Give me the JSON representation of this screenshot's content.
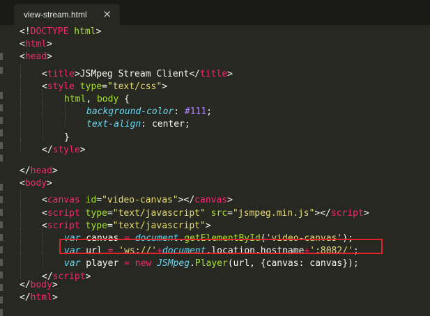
{
  "tab": {
    "title": "view-stream.html",
    "close_icon": "×"
  },
  "lines": [
    {
      "indent": 0,
      "tokens": [
        [
          "p",
          "<!"
        ],
        [
          "tg",
          "DOCTYPE"
        ],
        [
          "p",
          " "
        ],
        [
          "at",
          "html"
        ],
        [
          "p",
          ">"
        ]
      ]
    },
    {
      "indent": 0,
      "tokens": [
        [
          "p",
          "<"
        ],
        [
          "tg",
          "html"
        ],
        [
          "p",
          ">"
        ]
      ]
    },
    {
      "indent": 0,
      "tokens": [
        [
          "p",
          "<"
        ],
        [
          "tg",
          "head"
        ],
        [
          "p",
          ">"
        ]
      ]
    },
    {
      "indent": 1,
      "tokens": [
        [
          "p",
          "<"
        ],
        [
          "tg",
          "title"
        ],
        [
          "p",
          ">JSMpeg Stream Client</"
        ],
        [
          "tg",
          "title"
        ],
        [
          "p",
          ">"
        ]
      ]
    },
    {
      "indent": 1,
      "tokens": [
        [
          "p",
          "<"
        ],
        [
          "tg",
          "style"
        ],
        [
          "p",
          " "
        ],
        [
          "at",
          "type"
        ],
        [
          "p",
          "="
        ],
        [
          "st",
          "\"text/css\""
        ],
        [
          "p",
          ">"
        ]
      ]
    },
    {
      "indent": 2,
      "tokens": [
        [
          "sel",
          "html"
        ],
        [
          "p",
          ", "
        ],
        [
          "sel",
          "body"
        ],
        [
          "p",
          " {"
        ]
      ]
    },
    {
      "indent": 3,
      "tokens": [
        [
          "pr",
          "background-color"
        ],
        [
          "p",
          ": "
        ],
        [
          "nm",
          "#111"
        ],
        [
          "p",
          ";"
        ]
      ]
    },
    {
      "indent": 3,
      "tokens": [
        [
          "pr",
          "text-align"
        ],
        [
          "p",
          ": "
        ],
        [
          "p",
          "center"
        ],
        [
          "p",
          ";"
        ]
      ]
    },
    {
      "indent": 2,
      "tokens": [
        [
          "p",
          "}"
        ]
      ]
    },
    {
      "indent": 1,
      "tokens": [
        [
          "p",
          "</"
        ],
        [
          "tg",
          "style"
        ],
        [
          "p",
          ">"
        ]
      ]
    },
    {
      "indent": 0,
      "tokens": []
    },
    {
      "indent": 0,
      "tokens": [
        [
          "p",
          "</"
        ],
        [
          "tg",
          "head"
        ],
        [
          "p",
          ">"
        ]
      ]
    },
    {
      "indent": 0,
      "tokens": [
        [
          "p",
          "<"
        ],
        [
          "tg",
          "body"
        ],
        [
          "p",
          ">"
        ]
      ]
    },
    {
      "indent": 1,
      "tokens": [
        [
          "p",
          "<"
        ],
        [
          "tg",
          "canvas"
        ],
        [
          "p",
          " "
        ],
        [
          "at",
          "id"
        ],
        [
          "p",
          "="
        ],
        [
          "st",
          "\"video-canvas\""
        ],
        [
          "p",
          "></"
        ],
        [
          "tg",
          "canvas"
        ],
        [
          "p",
          ">"
        ]
      ]
    },
    {
      "indent": 1,
      "tokens": [
        [
          "p",
          "<"
        ],
        [
          "tg",
          "script"
        ],
        [
          "p",
          " "
        ],
        [
          "at",
          "type"
        ],
        [
          "p",
          "="
        ],
        [
          "st",
          "\"text/javascript\""
        ],
        [
          "p",
          " "
        ],
        [
          "at",
          "src"
        ],
        [
          "p",
          "="
        ],
        [
          "st",
          "\"jsmpeg.min.js\""
        ],
        [
          "p",
          "></"
        ],
        [
          "tg",
          "script"
        ],
        [
          "p",
          ">"
        ]
      ]
    },
    {
      "indent": 1,
      "tokens": [
        [
          "p",
          "<"
        ],
        [
          "tg",
          "script"
        ],
        [
          "p",
          " "
        ],
        [
          "at",
          "type"
        ],
        [
          "p",
          "="
        ],
        [
          "st",
          "\"text/javascript\""
        ],
        [
          "p",
          ">"
        ]
      ]
    },
    {
      "indent": 2,
      "tokens": [
        [
          "kw",
          "var"
        ],
        [
          "p",
          " canvas "
        ],
        [
          "op",
          "="
        ],
        [
          "p",
          " "
        ],
        [
          "cl",
          "document"
        ],
        [
          "p",
          "."
        ],
        [
          "fn",
          "getElementById"
        ],
        [
          "p",
          "("
        ],
        [
          "st",
          "'video-canvas'"
        ],
        [
          "p",
          ");"
        ]
      ]
    },
    {
      "indent": 2,
      "tokens": [
        [
          "kw",
          "var"
        ],
        [
          "p",
          " url "
        ],
        [
          "op",
          "="
        ],
        [
          "p",
          " "
        ],
        [
          "st",
          "'ws://'"
        ],
        [
          "op",
          "+"
        ],
        [
          "cl",
          "document"
        ],
        [
          "p",
          ".location.hostname"
        ],
        [
          "op",
          "+"
        ],
        [
          "st",
          "':8082/'"
        ],
        [
          "p",
          ";"
        ]
      ]
    },
    {
      "indent": 2,
      "tokens": [
        [
          "kw",
          "var"
        ],
        [
          "p",
          " player "
        ],
        [
          "op",
          "="
        ],
        [
          "p",
          " "
        ],
        [
          "op",
          "new"
        ],
        [
          "p",
          " "
        ],
        [
          "cl",
          "JSMpeg"
        ],
        [
          "p",
          "."
        ],
        [
          "fn",
          "Player"
        ],
        [
          "p",
          "(url, {canvas: canvas});"
        ]
      ]
    },
    {
      "indent": 1,
      "tokens": [
        [
          "p",
          "</"
        ],
        [
          "tg",
          "script"
        ],
        [
          "p",
          ">"
        ]
      ]
    },
    {
      "indent": 0,
      "tokens": [
        [
          "p",
          "</"
        ],
        [
          "tg",
          "body"
        ],
        [
          "p",
          ">"
        ]
      ]
    },
    {
      "indent": 0,
      "tokens": [
        [
          "p",
          "</"
        ],
        [
          "tg",
          "html"
        ],
        [
          "p",
          ">"
        ]
      ]
    }
  ],
  "highlighted_line": 17,
  "colors": {
    "background": "#272822",
    "tag": "#f92672",
    "attribute": "#a6e22e",
    "string": "#e6db74",
    "keyword": "#66d9ef",
    "number": "#ae81ff",
    "highlight_box": "#e0242b"
  }
}
